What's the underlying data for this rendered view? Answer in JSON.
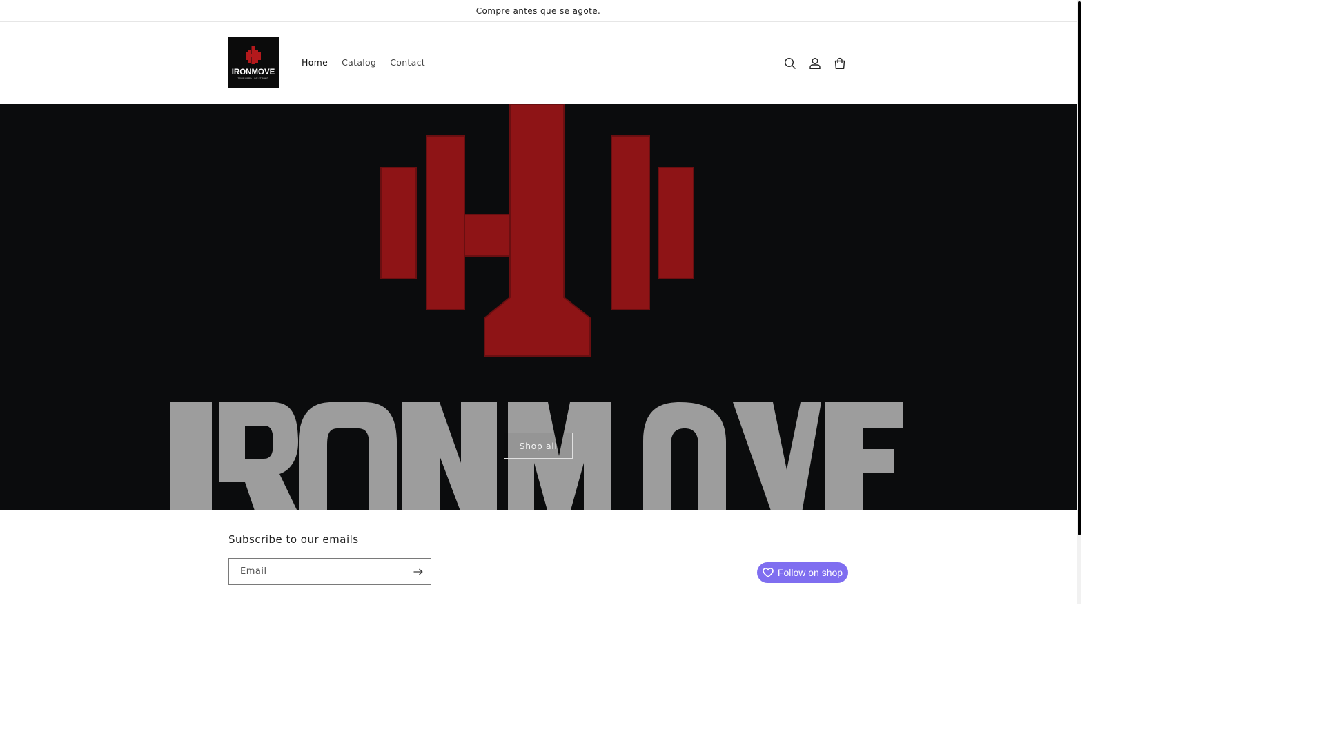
{
  "announcement": {
    "text": "Compre antes que se agote."
  },
  "brand": {
    "logo_text": "IRONMOVE",
    "logo_tagline": "TRAIN HARD. LIVE STRONG.",
    "accent_color": "#b3191c"
  },
  "nav": {
    "items": [
      {
        "label": "Home",
        "active": true
      },
      {
        "label": "Catalog",
        "active": false
      },
      {
        "label": "Contact",
        "active": false
      }
    ]
  },
  "header_icons": [
    "search-icon",
    "account-icon",
    "cart-icon"
  ],
  "hero": {
    "button_label": "Shop all",
    "background_text": "IRONMOVE"
  },
  "newsletter": {
    "title": "Subscribe to our emails",
    "email_placeholder": "Email"
  },
  "follow": {
    "label": "Follow on shop",
    "color": "#7f6ef0"
  }
}
